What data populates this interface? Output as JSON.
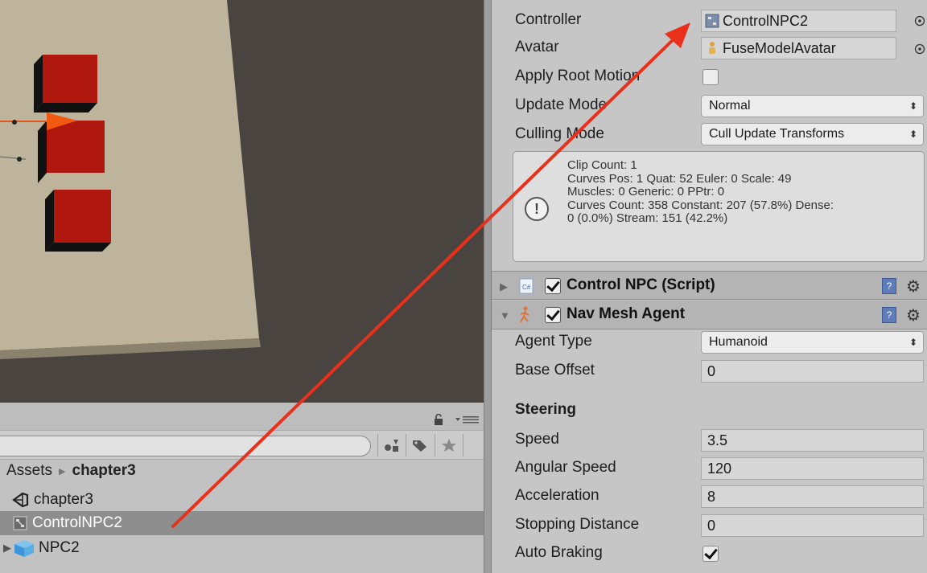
{
  "colors": {
    "arrow": "#e8301b",
    "cube": "#b0180f",
    "floor": "#bdb49b",
    "scene_bg": "#4a4440",
    "selection": "#8e8e8e"
  },
  "project": {
    "breadcrumb": {
      "root": "Assets",
      "current": "chapter3"
    },
    "items": [
      {
        "label": "chapter3",
        "icon": "unity-scene-icon",
        "selected": false
      },
      {
        "label": "ControlNPC2",
        "icon": "animator-controller-icon",
        "selected": true
      },
      {
        "label": "NPC2",
        "icon": "prefab-cube-icon",
        "selected": false
      }
    ]
  },
  "inspector": {
    "animator": {
      "controller_label": "Controller",
      "controller_value": "ControlNPC2",
      "avatar_label": "Avatar",
      "avatar_value": "FuseModelAvatar",
      "apply_root_motion_label": "Apply Root Motion",
      "apply_root_motion": false,
      "update_mode_label": "Update Mode",
      "update_mode_value": "Normal",
      "culling_mode_label": "Culling Mode",
      "culling_mode_value": "Cull Update Transforms",
      "info_lines": [
        "Clip Count: 1",
        "Curves Pos: 1 Quat: 52 Euler: 0 Scale: 49",
        "Muscles: 0 Generic: 0 PPtr: 0",
        "Curves Count: 358 Constant: 207 (57.8%) Dense:",
        "0 (0.0%) Stream: 151 (42.2%)"
      ]
    },
    "script_component": {
      "title": "Control NPC (Script)",
      "enabled": true
    },
    "nav_mesh_agent": {
      "title": "Nav Mesh Agent",
      "enabled": true,
      "agent_type_label": "Agent Type",
      "agent_type_value": "Humanoid",
      "base_offset_label": "Base Offset",
      "base_offset_value": "0",
      "steering_heading": "Steering",
      "speed_label": "Speed",
      "speed_value": "3.5",
      "angular_speed_label": "Angular Speed",
      "angular_speed_value": "120",
      "acceleration_label": "Acceleration",
      "acceleration_value": "8",
      "stopping_distance_label": "Stopping Distance",
      "stopping_distance_value": "0",
      "auto_braking_label": "Auto Braking",
      "auto_braking": true
    }
  }
}
